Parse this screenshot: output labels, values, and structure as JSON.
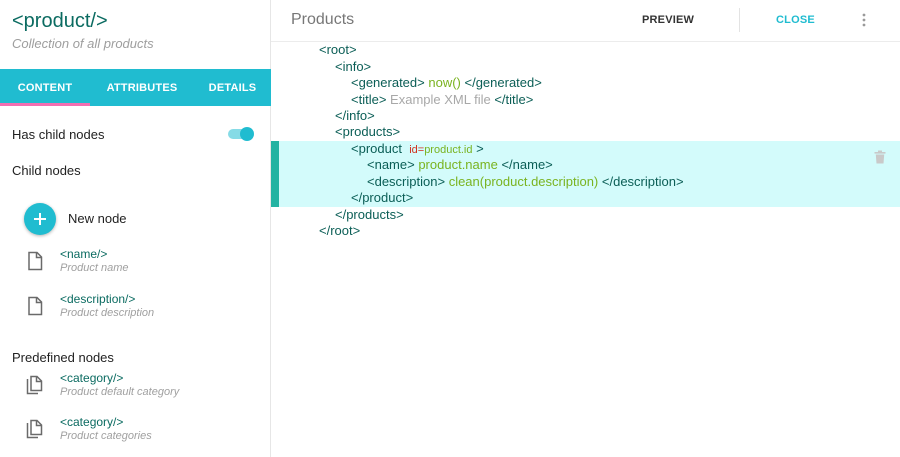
{
  "sidebar": {
    "title": "<product/>",
    "subtitle": "Collection of all products",
    "tabs": [
      {
        "label": "CONTENT",
        "active": true
      },
      {
        "label": "ATTRIBUTES",
        "active": false
      },
      {
        "label": "DETAILS",
        "active": false
      }
    ],
    "has_child_nodes_label": "Has child nodes",
    "has_child_nodes_value": true,
    "child_nodes_label": "Child nodes",
    "new_node_label": "New node",
    "child_nodes": [
      {
        "name": "<name/>",
        "description": "Product name",
        "icon": "file-icon"
      },
      {
        "name": "<description/>",
        "description": "Product description",
        "icon": "file-icon"
      }
    ],
    "predefined_nodes_label": "Predefined nodes",
    "predefined_nodes": [
      {
        "name": "<category/>",
        "description": "Product default category",
        "icon": "files-copy-icon"
      },
      {
        "name": "<category/>",
        "description": "Product categories",
        "icon": "files-copy-icon"
      }
    ]
  },
  "main": {
    "title": "Products",
    "preview_label": "PREVIEW",
    "close_label": "CLOSE",
    "more_icon": "more-vert-icon",
    "delete_icon": "trash-icon",
    "colors": {
      "accent": "#20bcd0",
      "highlight": "#d3fbfb",
      "highlight_bar": "#23b3a2",
      "tag": "#0b5e56",
      "expression": "#7ab320",
      "attribute": "#d0321f"
    },
    "code": {
      "root_open": "<root>",
      "info_open": "<info>",
      "generated_open": "<generated>",
      "generated_expr": "now()",
      "generated_close": "</generated>",
      "title_open": "<title>",
      "title_text": "Example XML file",
      "title_close": "</title>",
      "info_close": "</info>",
      "products_open": "<products>",
      "product_open": "<product",
      "product_attr_name": "id=",
      "product_attr_value": "product.id",
      "product_open_end": ">",
      "name_open": "<name>",
      "name_expr": "product.name",
      "name_close": "</name>",
      "description_open": "<description>",
      "description_expr": "clean(product.description)",
      "description_close": "</description>",
      "product_close": "</product>",
      "products_close": "</products>",
      "root_close": "</root>"
    }
  }
}
